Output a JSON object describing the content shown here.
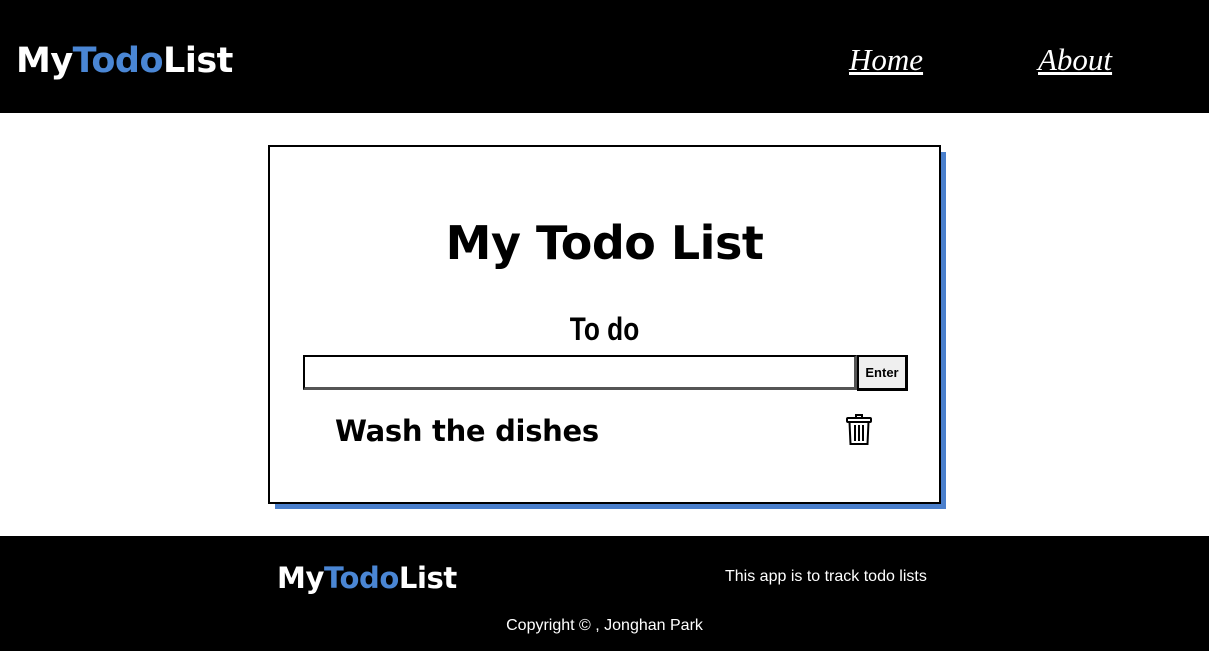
{
  "header": {
    "logo": {
      "part1": "My",
      "part2": "Todo",
      "part3": "List"
    },
    "nav": [
      {
        "label": "Home"
      },
      {
        "label": "About"
      }
    ]
  },
  "main": {
    "title": "My Todo List",
    "section_label": "To do",
    "input": {
      "value": "",
      "placeholder": ""
    },
    "enter_label": "Enter",
    "todos": [
      {
        "text": "Wash the dishes",
        "icon": "trash-icon"
      }
    ]
  },
  "footer": {
    "logo": {
      "part1": "My",
      "part2": "Todo",
      "part3": "List"
    },
    "description": "This app is to track todo lists",
    "copyright": "Copyright © , Jonghan Park"
  },
  "colors": {
    "accent": "#4a86d4",
    "header_bg": "#000000",
    "card_shadow": "#4a7fcc"
  }
}
